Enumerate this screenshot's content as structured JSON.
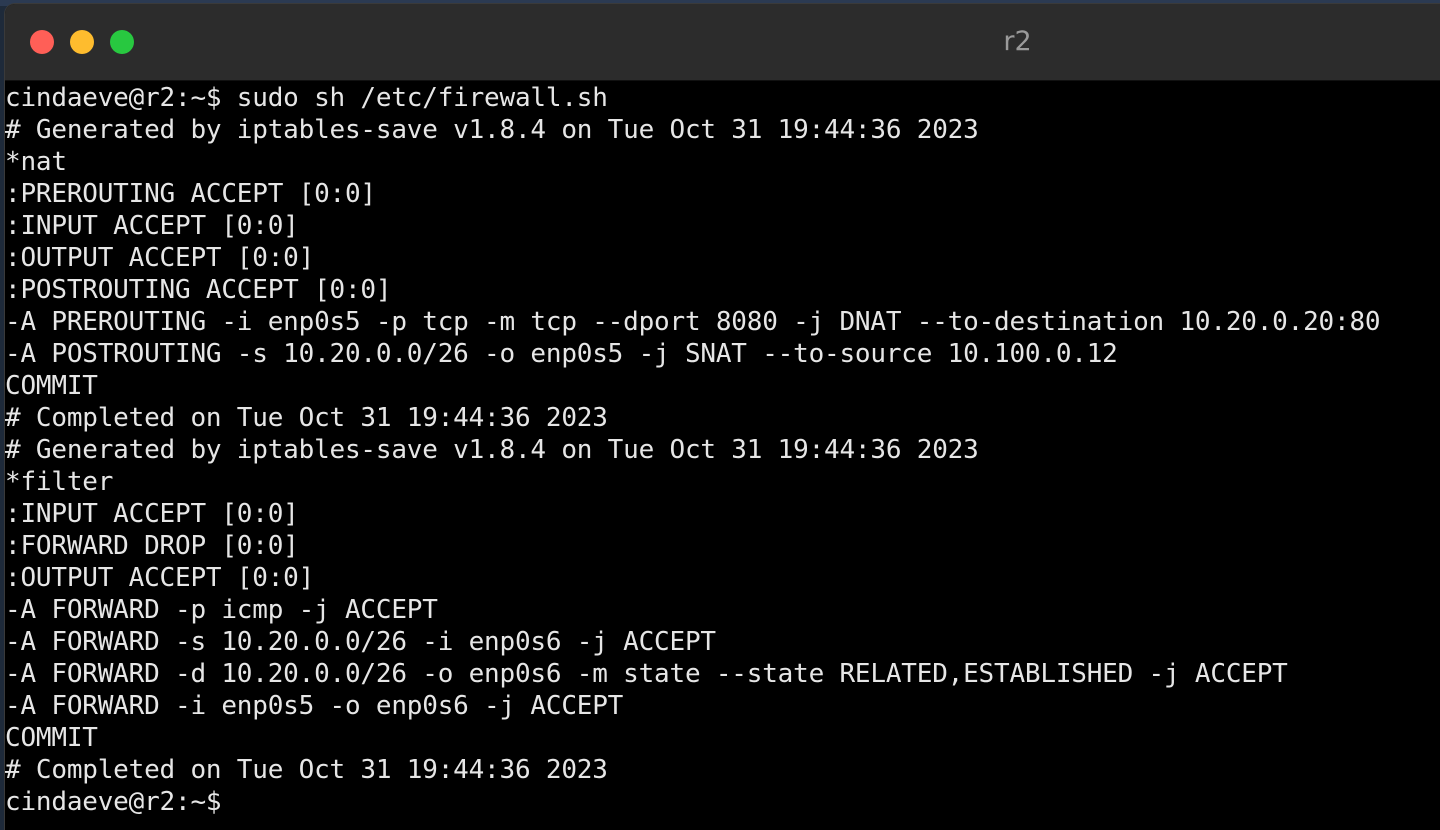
{
  "window": {
    "title": "r2"
  },
  "terminal": {
    "lines": [
      "cindaeve@r2:~$ sudo sh /etc/firewall.sh",
      "# Generated by iptables-save v1.8.4 on Tue Oct 31 19:44:36 2023",
      "*nat",
      ":PREROUTING ACCEPT [0:0]",
      ":INPUT ACCEPT [0:0]",
      ":OUTPUT ACCEPT [0:0]",
      ":POSTROUTING ACCEPT [0:0]",
      "-A PREROUTING -i enp0s5 -p tcp -m tcp --dport 8080 -j DNAT --to-destination 10.20.0.20:80",
      "-A POSTROUTING -s 10.20.0.0/26 -o enp0s5 -j SNAT --to-source 10.100.0.12",
      "COMMIT",
      "# Completed on Tue Oct 31 19:44:36 2023",
      "# Generated by iptables-save v1.8.4 on Tue Oct 31 19:44:36 2023",
      "*filter",
      ":INPUT ACCEPT [0:0]",
      ":FORWARD DROP [0:0]",
      ":OUTPUT ACCEPT [0:0]",
      "-A FORWARD -p icmp -j ACCEPT",
      "-A FORWARD -s 10.20.0.0/26 -i enp0s6 -j ACCEPT",
      "-A FORWARD -d 10.20.0.0/26 -o enp0s6 -m state --state RELATED,ESTABLISHED -j ACCEPT",
      "-A FORWARD -i enp0s5 -o enp0s6 -j ACCEPT",
      "COMMIT",
      "# Completed on Tue Oct 31 19:44:36 2023",
      "cindaeve@r2:~$"
    ]
  },
  "colors": {
    "close": "#ff5f57",
    "minimize": "#febc2e",
    "zoom": "#28c840",
    "terminal_bg": "#000000",
    "terminal_fg": "#e6e6e6",
    "titlebar_bg": "#2c2c2c"
  }
}
